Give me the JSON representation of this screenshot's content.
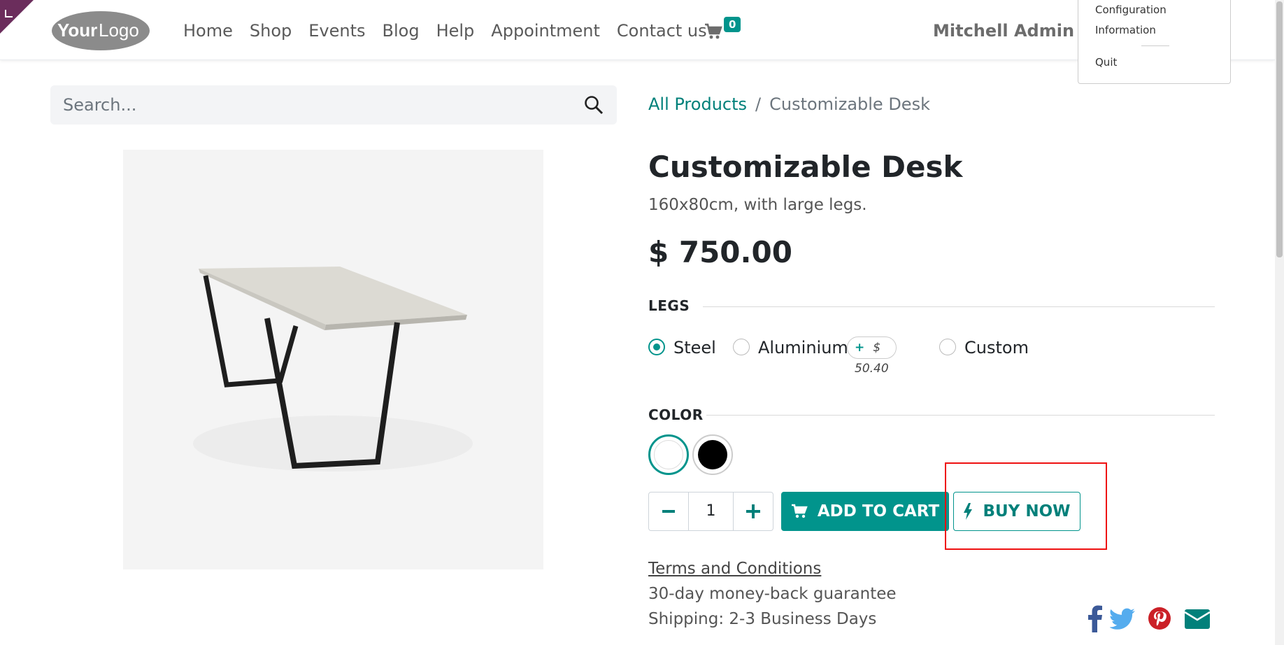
{
  "header": {
    "logo_text": "YourLogo",
    "nav": [
      "Home",
      "Shop",
      "Events",
      "Blog",
      "Help",
      "Appointment",
      "Contact us"
    ],
    "cart_count": "0",
    "user_name": "Mitchell Admin"
  },
  "user_menu": {
    "items": [
      "Configuration",
      "Information",
      "Quit"
    ]
  },
  "search": {
    "placeholder": "Search..."
  },
  "breadcrumb": {
    "parent": "All Products",
    "separator": "/",
    "current": "Customizable Desk"
  },
  "product": {
    "title": "Customizable Desk",
    "description": "160x80cm, with large legs.",
    "price": "$ 750.00"
  },
  "legs": {
    "heading": "LEGS",
    "options": [
      "Steel",
      "Aluminium",
      "Custom"
    ],
    "selected": "Steel",
    "aluminium_extra": "$ 50.40",
    "extra_prefix": "+"
  },
  "color": {
    "heading": "COLOR",
    "swatches": [
      "#ffffff",
      "#000000"
    ],
    "selected": "#ffffff"
  },
  "actions": {
    "quantity": "1",
    "add_to_cart": "ADD TO CART",
    "buy_now": "BUY NOW"
  },
  "info": {
    "terms": "Terms and Conditions",
    "guarantee": "30-day money-back guarantee",
    "shipping": "Shipping: 2-3 Business Days"
  },
  "social": [
    "facebook-icon",
    "twitter-icon",
    "pinterest-icon",
    "email-icon"
  ],
  "colors": {
    "accent": "#01948c",
    "highlight": "#ee1111",
    "corner": "#6b2d5c"
  }
}
